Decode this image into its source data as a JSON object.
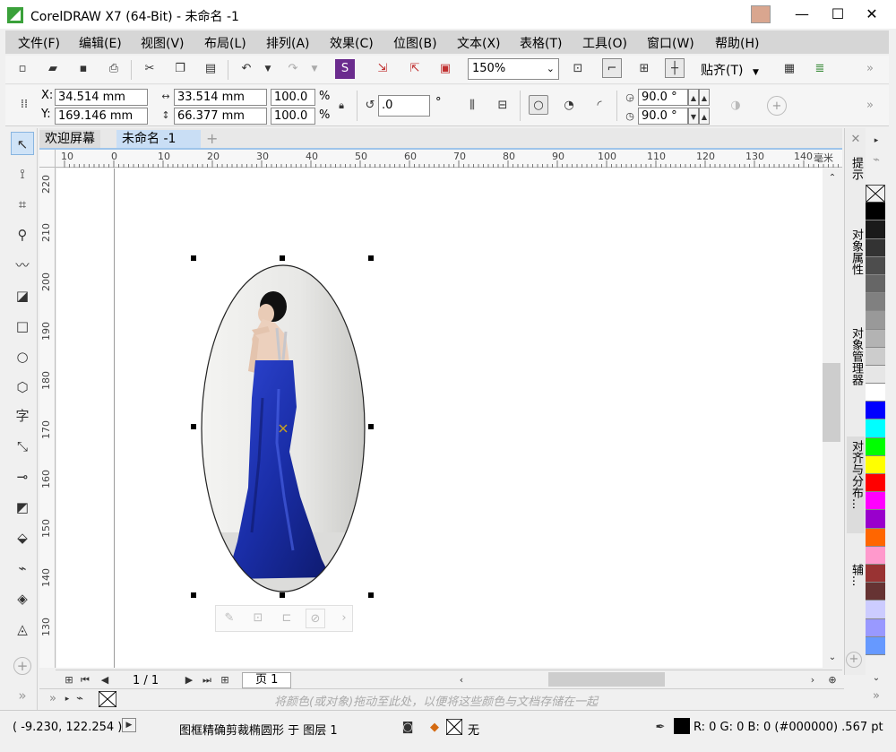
{
  "window": {
    "title": "CorelDRAW X7 (64-Bit) - 未命名 -1",
    "minimize": "—",
    "maximize": "☐",
    "close": "✕"
  },
  "menu": [
    "文件(F)",
    "编辑(E)",
    "视图(V)",
    "布局(L)",
    "排列(A)",
    "效果(C)",
    "位图(B)",
    "文本(X)",
    "表格(T)",
    "工具(O)",
    "窗口(W)",
    "帮助(H)"
  ],
  "toolbar": {
    "zoom": "150%",
    "snap_label": "贴齐(T)",
    "more": "»"
  },
  "property_bar": {
    "x_label": "X:",
    "x_value": "34.514 mm",
    "y_label": "Y:",
    "y_value": "169.146 mm",
    "width_value": "33.514 mm",
    "height_value": "66.377 mm",
    "scale_x": "100.0",
    "scale_y": "100.0",
    "percent": "%",
    "rotation": ".0",
    "degree": "°",
    "start_angle": "90.0 °",
    "end_angle": "90.0 °"
  },
  "tabs": {
    "welcome": "欢迎屏幕",
    "document": "未命名 -1",
    "add": "+"
  },
  "ruler": {
    "unit": "毫米",
    "h_ticks": [
      "10",
      "0",
      "10",
      "20",
      "30",
      "40",
      "50",
      "60",
      "70",
      "80",
      "90",
      "100",
      "110",
      "120",
      "130",
      "140"
    ],
    "v_ticks": [
      "220",
      "210",
      "200",
      "190",
      "180",
      "170",
      "160",
      "150",
      "140",
      "130"
    ]
  },
  "page_nav": {
    "page_count": "1 / 1",
    "page_tab": "页 1"
  },
  "dockers": [
    "提示",
    "对象属性",
    "对象管理器",
    "对齐与分布...",
    "辅..."
  ],
  "palette": [
    "#ffffff",
    "#000000",
    "#1a1a1a",
    "#333333",
    "#4d4d4d",
    "#666666",
    "#808080",
    "#999999",
    "#b3b3b3",
    "#cccccc",
    "#e6e6e6",
    "#ffffff",
    "#0000ff",
    "#00ffff",
    "#00ff00",
    "#ffff00",
    "#ff0000",
    "#ff00ff",
    "#9900cc",
    "#ff6600",
    "#ff99cc",
    "#993333",
    "#663333",
    "#ccccff",
    "#9999ff",
    "#6699ff"
  ],
  "colorwell_hint": "将颜色(或对象)拖动至此处，以便将这些颜色与文档存储在一起",
  "status": {
    "coords": "( -9.230, 122.254 )",
    "description": "图框精确剪裁椭圆形 于 图层 1",
    "fill_none": "无",
    "outline": "R: 0 G: 0 B: 0 (#000000) .567 pt"
  },
  "colors": {
    "dress": "#1a2ea8",
    "accent_tab": "#9ec4ea"
  }
}
